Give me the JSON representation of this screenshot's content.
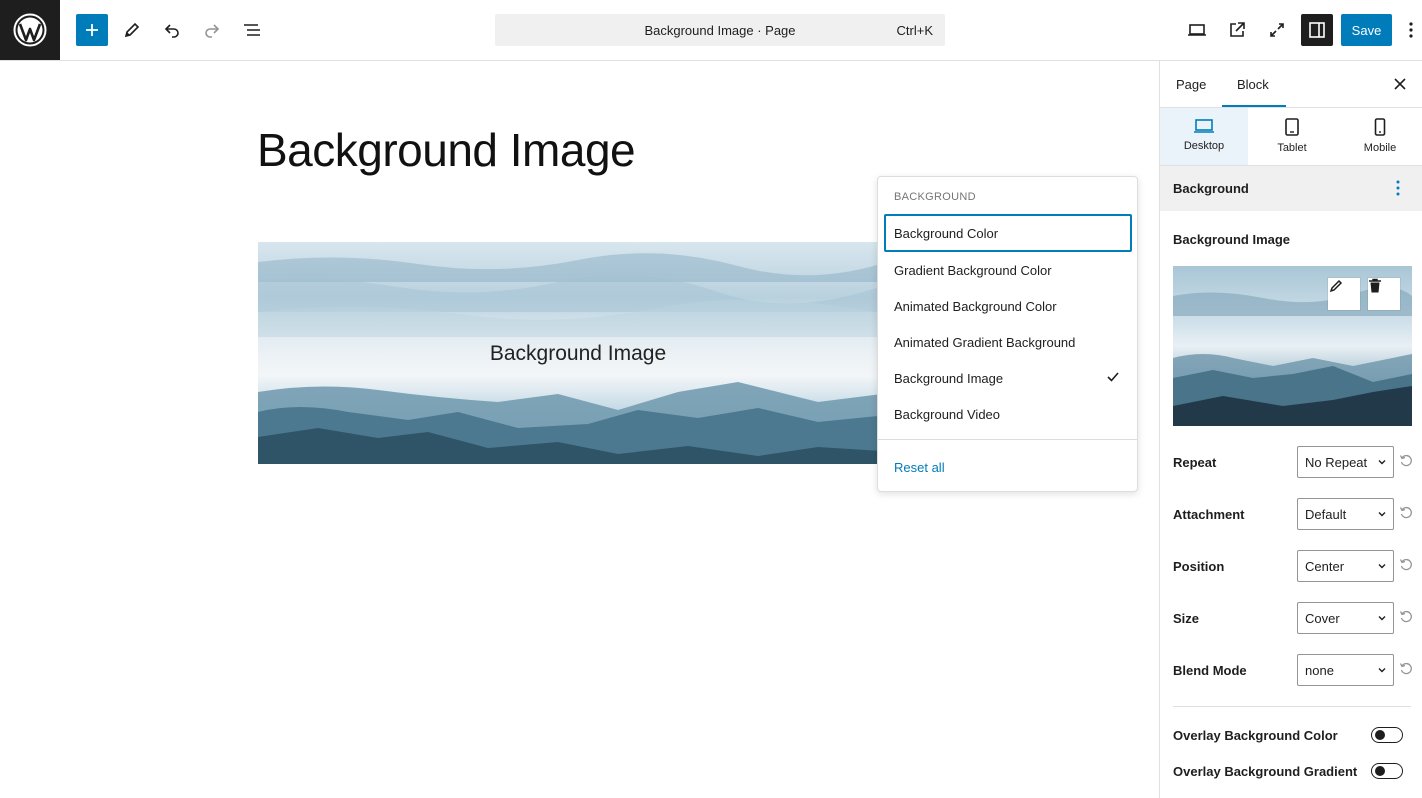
{
  "toolbar": {
    "document_title": "Background Image · Page",
    "shortcut": "Ctrl+K",
    "save_label": "Save",
    "accent_color": "#007cba"
  },
  "canvas": {
    "page_title": "Background Image",
    "block_text": "Background Image"
  },
  "dropdown": {
    "heading": "Background",
    "items": [
      {
        "label": "Background Color",
        "focused": true,
        "checked": false
      },
      {
        "label": "Gradient Background Color",
        "focused": false,
        "checked": false
      },
      {
        "label": "Animated Background Color",
        "focused": false,
        "checked": false
      },
      {
        "label": "Animated Gradient Background",
        "focused": false,
        "checked": false
      },
      {
        "label": "Background Image",
        "focused": false,
        "checked": true
      },
      {
        "label": "Background Video",
        "focused": false,
        "checked": false
      }
    ],
    "reset_label": "Reset all"
  },
  "sidebar": {
    "tabs": [
      {
        "label": "Page",
        "active": false
      },
      {
        "label": "Block",
        "active": true
      }
    ],
    "devices": [
      {
        "label": "Desktop",
        "active": true
      },
      {
        "label": "Tablet",
        "active": false
      },
      {
        "label": "Mobile",
        "active": false
      }
    ],
    "section_title": "Background",
    "image_label": "Background Image",
    "settings": [
      {
        "label": "Repeat",
        "value": "No Repeat"
      },
      {
        "label": "Attachment",
        "value": "Default"
      },
      {
        "label": "Position",
        "value": "Center"
      },
      {
        "label": "Size",
        "value": "Cover"
      },
      {
        "label": "Blend Mode",
        "value": "none"
      }
    ],
    "toggles": [
      {
        "label": "Overlay Background Color",
        "on": false
      },
      {
        "label": "Overlay Background Gradient",
        "on": false
      }
    ]
  }
}
